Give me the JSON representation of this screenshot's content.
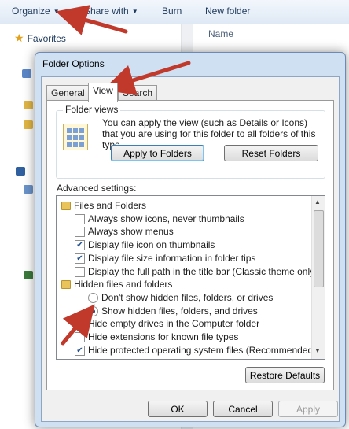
{
  "toolbar": {
    "organize": "Organize",
    "share_with": "Share with",
    "burn": "Burn",
    "new_folder": "New folder"
  },
  "nav": {
    "favorites": "Favorites"
  },
  "content": {
    "col_name": "Name"
  },
  "dialog": {
    "title": "Folder Options",
    "tabs": [
      "General",
      "View",
      "Search"
    ],
    "active_tab": "View",
    "folder_views": {
      "label": "Folder views",
      "description": "You can apply the view (such as Details or Icons) that you are using for this folder to all folders of this type.",
      "apply_button": "Apply to Folders",
      "reset_button": "Reset Folders"
    },
    "advanced_label": "Advanced settings:",
    "advanced_items": [
      {
        "type": "folder",
        "label": "Files and Folders"
      },
      {
        "type": "checkbox",
        "checked": false,
        "label": "Always show icons, never thumbnails"
      },
      {
        "type": "checkbox",
        "checked": false,
        "label": "Always show menus"
      },
      {
        "type": "checkbox",
        "checked": true,
        "label": "Display file icon on thumbnails"
      },
      {
        "type": "checkbox",
        "checked": true,
        "label": "Display file size information in folder tips"
      },
      {
        "type": "checkbox",
        "checked": false,
        "label": "Display the full path in the title bar (Classic theme only)"
      },
      {
        "type": "folder",
        "label": "Hidden files and folders"
      },
      {
        "type": "radio",
        "checked": false,
        "label": "Don't show hidden files, folders, or drives"
      },
      {
        "type": "radio",
        "checked": true,
        "label": "Show hidden files, folders, and drives"
      },
      {
        "type": "checkbox",
        "checked": false,
        "label": "Hide empty drives in the Computer folder"
      },
      {
        "type": "checkbox",
        "checked": false,
        "label": "Hide extensions for known file types"
      },
      {
        "type": "checkbox",
        "checked": true,
        "label": "Hide protected operating system files (Recommended)"
      }
    ],
    "restore_button": "Restore Defaults",
    "ok_button": "OK",
    "cancel_button": "Cancel",
    "apply_button": "Apply"
  },
  "colors": {
    "annotation_arrow": "#c0392b",
    "dialog_frame": "#cfe0f3"
  }
}
